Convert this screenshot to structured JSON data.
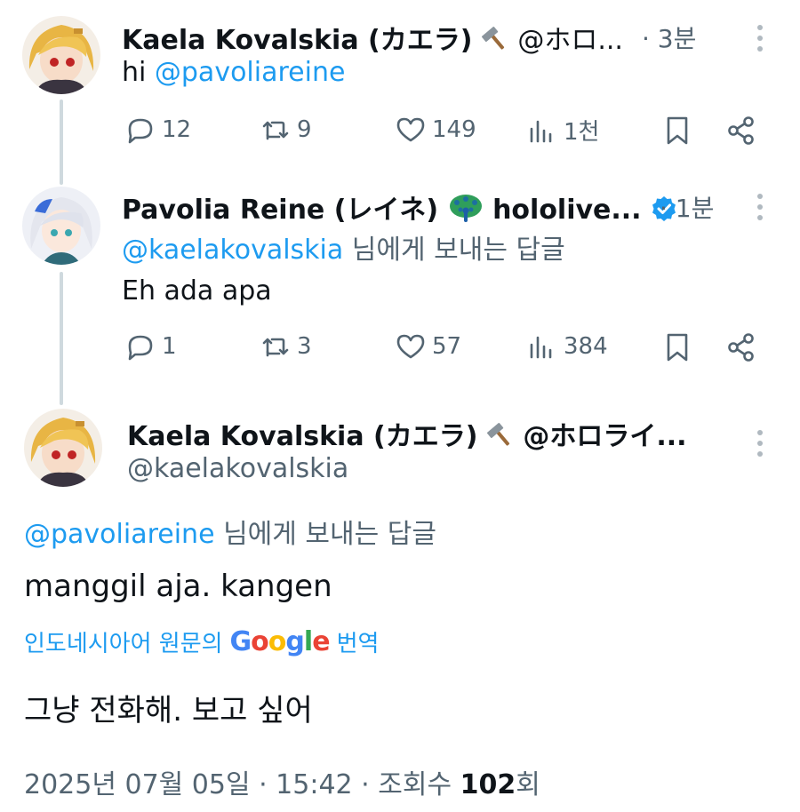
{
  "tweets": [
    {
      "display_name": "Kaela Kovalskia (カエラ)",
      "name_emoji": "hammer",
      "handle": "@ホロ...",
      "time": "· 3분",
      "text_prefix": "hi ",
      "mention": "@pavoliareine",
      "stats": {
        "replies": "12",
        "retweets": "9",
        "likes": "149",
        "views": "1천"
      }
    },
    {
      "display_name": "Pavolia Reine (レイネ)",
      "name_emoji": "peacock",
      "name_suffix": "hololive...",
      "verified": true,
      "time": "· 1분",
      "reply_to_mention": "@kaelakovalskia",
      "reply_to_suffix": " 님에게 보내는 답글",
      "text": "Eh ada apa",
      "stats": {
        "replies": "1",
        "retweets": "3",
        "likes": "57",
        "views": "384"
      }
    }
  ],
  "main_tweet": {
    "display_name": "Kaela Kovalskia (カエラ)",
    "name_emoji": "hammer",
    "name_suffix": "@ホロライ...",
    "handle": "@kaelakovalskia",
    "reply_to_mention": "@pavoliareine",
    "reply_to_suffix": " 님에게 보내는 답글",
    "text": "manggil aja. kangen",
    "translate_prefix": "인도네시아어 원문의",
    "translate_brand": "Google",
    "translate_suffix": "번역",
    "translated_text": "그냥 전화해. 보고 싶어",
    "meta_date": "2025년 07월 05일 · 15:42 · 조회수 ",
    "meta_views": "102",
    "meta_suffix": "회"
  },
  "colors": {
    "accent": "#1d9bf0",
    "muted": "#536471",
    "text": "#0f1419",
    "thread_line": "#cfd9de",
    "verified": "#1d9bf0"
  }
}
